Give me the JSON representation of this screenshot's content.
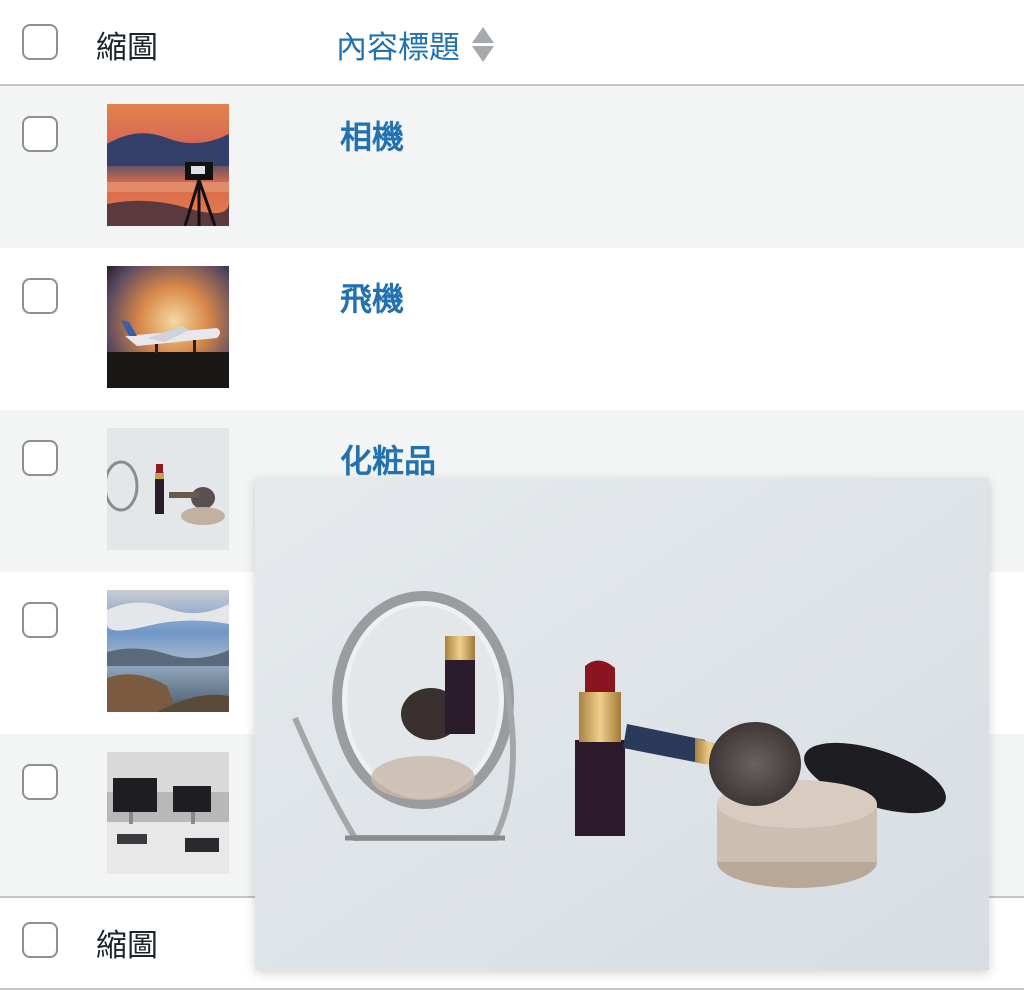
{
  "header": {
    "thumbnail_label": "縮圖",
    "title_label": "內容標題"
  },
  "footer": {
    "thumbnail_label": "縮圖"
  },
  "rows": [
    {
      "title": "相機",
      "thumbnail": "camera-sunset-photo"
    },
    {
      "title": "飛機",
      "thumbnail": "airplane-sunset-photo"
    },
    {
      "title": "化粧品",
      "thumbnail": "cosmetics-photo"
    },
    {
      "title": "",
      "thumbnail": "mountain-coast-photo"
    },
    {
      "title": "",
      "thumbnail": "desk-workspace-photo"
    }
  ],
  "preview": {
    "subject": "cosmetics-photo"
  },
  "colors": {
    "link": "#2271b1",
    "row_alt": "#f3f5f5",
    "border": "#c3c4c7",
    "checkbox_border": "#8c8f94"
  }
}
